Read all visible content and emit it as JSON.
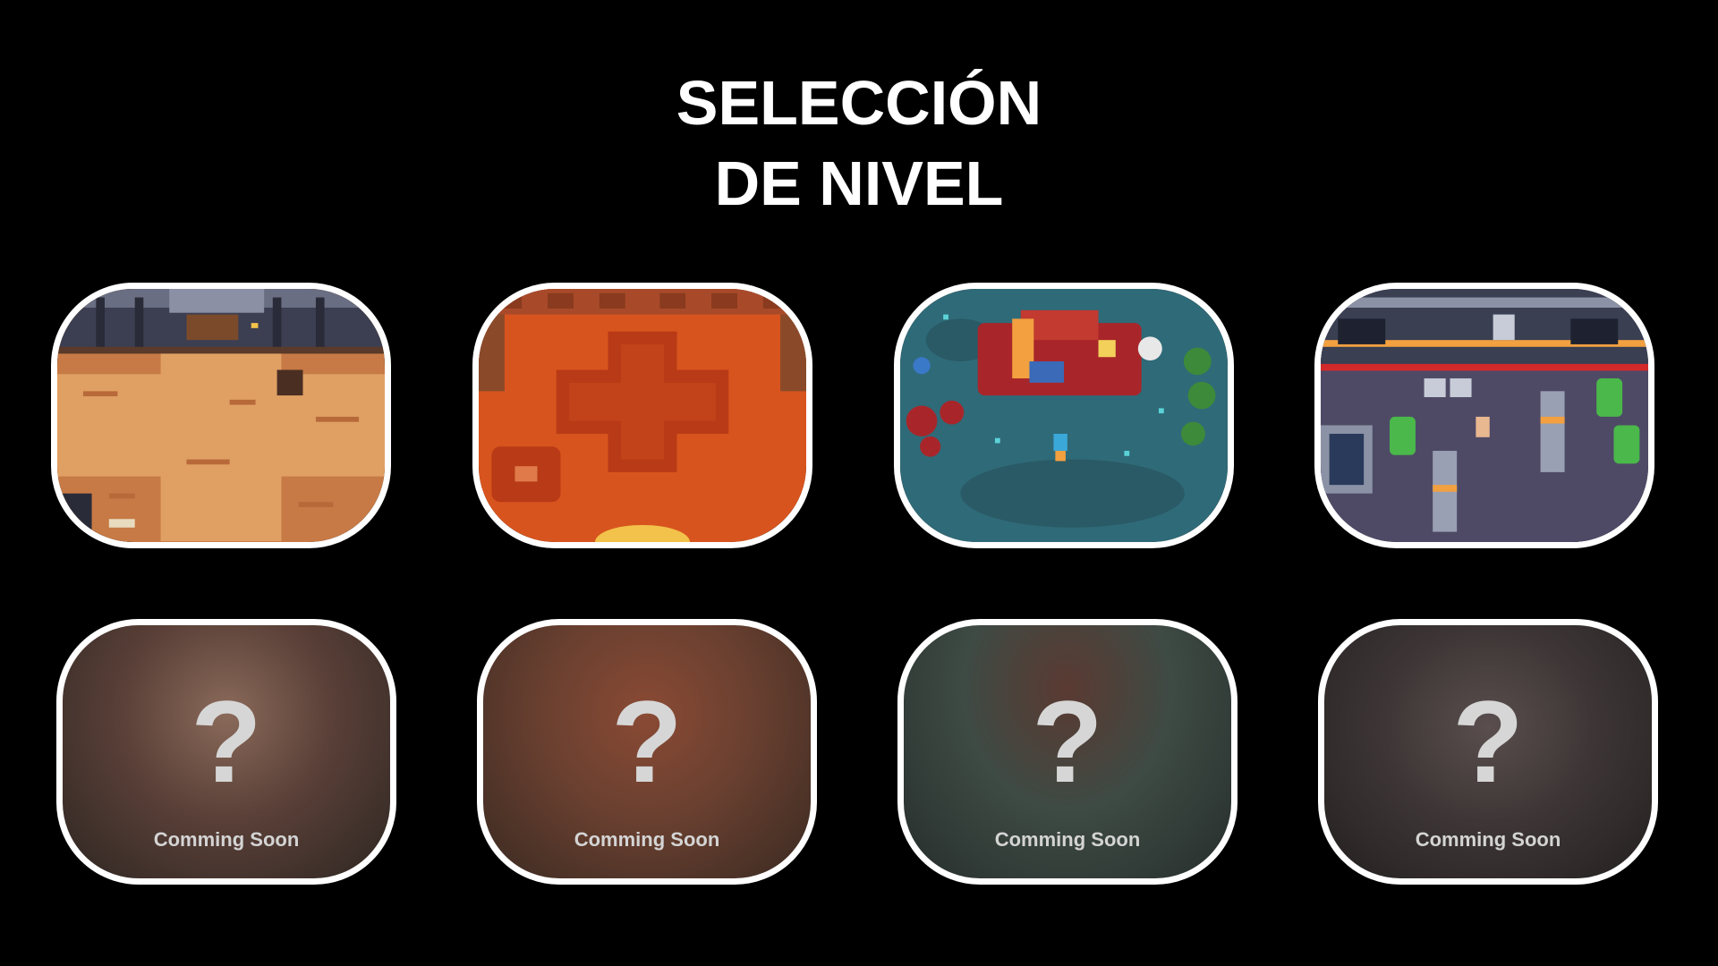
{
  "header": {
    "title_line1": "SELECCIÓN",
    "title_line2": "DE NIVEL"
  },
  "levels": [
    {
      "scene": "dungeon-brick-room",
      "locked": false
    },
    {
      "scene": "desert-cross-arena",
      "locked": false
    },
    {
      "scene": "forest-crashed-vehicle",
      "locked": false
    },
    {
      "scene": "industrial-lab",
      "locked": false
    }
  ],
  "locked_levels": [
    {
      "mark": "?",
      "label": "Comming Soon",
      "tint": "#8a6a5a"
    },
    {
      "mark": "?",
      "label": "Comming Soon",
      "tint": "#8a4a34"
    },
    {
      "mark": "?",
      "label": "Comming Soon",
      "tint": "#5a4a44"
    },
    {
      "mark": "?",
      "label": "Comming Soon",
      "tint": "#5a4e4e"
    }
  ]
}
